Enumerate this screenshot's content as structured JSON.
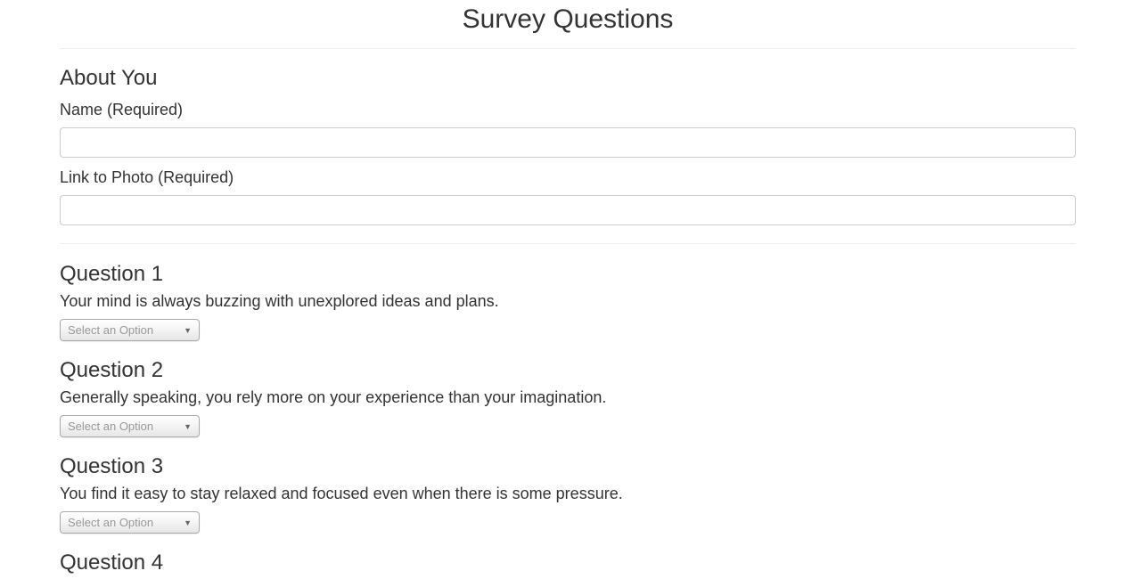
{
  "page": {
    "title": "Survey Questions"
  },
  "about": {
    "heading": "About You",
    "name_label": "Name (Required)",
    "name_value": "",
    "photo_label": "Link to Photo (Required)",
    "photo_value": ""
  },
  "questions": [
    {
      "title": "Question 1",
      "text": "Your mind is always buzzing with unexplored ideas and plans.",
      "select_value": "Select an Option"
    },
    {
      "title": "Question 2",
      "text": "Generally speaking, you rely more on your experience than your imagination.",
      "select_value": "Select an Option"
    },
    {
      "title": "Question 3",
      "text": "You find it easy to stay relaxed and focused even when there is some pressure.",
      "select_value": "Select an Option"
    },
    {
      "title": "Question 4"
    }
  ],
  "icons": {
    "select_arrow": "triangle-down-icon"
  },
  "colors": {
    "text": "#333333",
    "border": "#cccccc",
    "divider": "#eeeeee",
    "placeholder": "#999999"
  }
}
